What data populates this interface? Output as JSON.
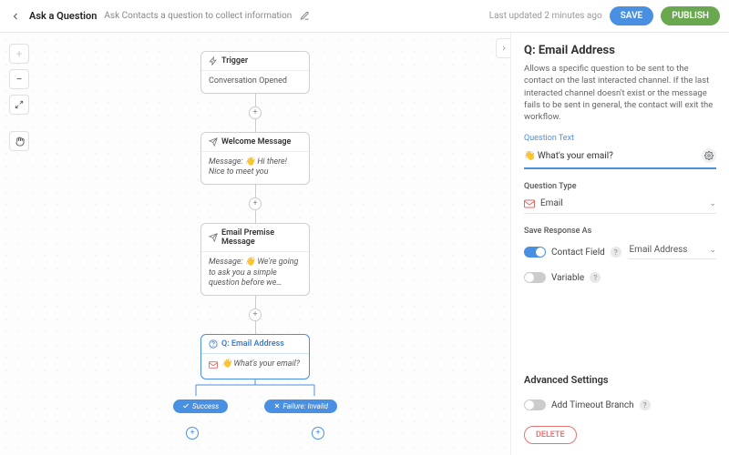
{
  "header": {
    "title": "Ask a Question",
    "subtitle": "Ask Contacts a question to collect information",
    "last_updated": "Last updated 2 minutes ago",
    "save_label": "SAVE",
    "publish_label": "PUBLISH"
  },
  "flow": {
    "trigger": {
      "title": "Trigger",
      "body": "Conversation Opened"
    },
    "welcome": {
      "title": "Welcome Message",
      "body": "Message: 👋 Hi there! Nice to meet you"
    },
    "premise": {
      "title": "Email Premise Message",
      "body": "Message: 👋 We're going to ask you a simple question before we…"
    },
    "question": {
      "title": "Q: Email Address",
      "body": "👋 What's your email?"
    },
    "branches": {
      "success": "Success",
      "failure": "Failure: Invalid"
    }
  },
  "panel": {
    "title": "Q: Email Address",
    "description": "Allows a specific question to be sent to the contact on the last interacted channel. If the last interacted channel doesn't exist or the message fails to be sent in general, the contact will exit the workflow.",
    "question_text_label": "Question Text",
    "question_text_value": "👋 What's your email?",
    "question_type_label": "Question Type",
    "question_type_value": "Email",
    "save_response_label": "Save Response As",
    "contact_field_label": "Contact Field",
    "contact_field_value": "Email Address",
    "variable_label": "Variable",
    "advanced_label": "Advanced Settings",
    "timeout_label": "Add Timeout Branch",
    "delete_label": "DELETE"
  }
}
